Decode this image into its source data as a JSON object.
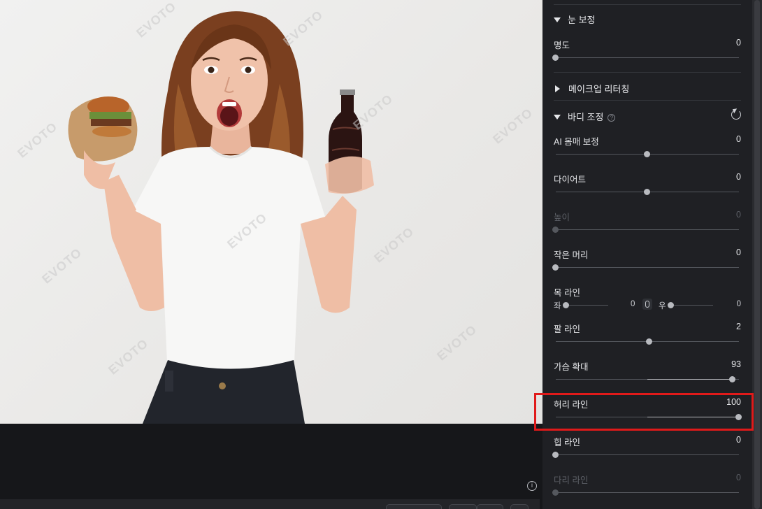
{
  "canvas": {
    "watermark_text": "EVOTO",
    "info_icon": "info-icon"
  },
  "panel": {
    "eye_section": {
      "title": "눈 보정",
      "icon": "triangle-down-icon"
    },
    "brightness": {
      "label": "명도",
      "value": "0",
      "level": 0
    },
    "makeup_section": {
      "title": "메이크업 리터칭",
      "icon": "triangle-right-icon"
    },
    "body_section": {
      "title": "바디 조정",
      "help_icon": "question-icon",
      "reset_icon": "reset-icon"
    },
    "sliders": [
      {
        "label": "AI 몸매 보정",
        "value": "0",
        "level": 0.5,
        "disabled": false
      },
      {
        "label": "다이어트",
        "value": "0",
        "level": 0.5,
        "disabled": false
      },
      {
        "label": "높이",
        "value": "0",
        "level": 0,
        "disabled": true
      },
      {
        "label": "작은 머리",
        "value": "0",
        "level": 0,
        "disabled": false
      }
    ],
    "neck": {
      "label": "목 라인",
      "left_label": "좌",
      "left_value": "0",
      "right_label": "우",
      "right_value": "0",
      "link_icon": "link-icon"
    },
    "sliders2": [
      {
        "label": "팔 라인",
        "value": "2",
        "level": 0.51,
        "disabled": false
      },
      {
        "label": "가슴 확대",
        "value": "93",
        "level": 0.965,
        "disabled": false
      },
      {
        "label": "허리 라인",
        "value": "100",
        "level": 1.0,
        "disabled": false
      },
      {
        "label": "힙 라인",
        "value": "0",
        "level": 0,
        "disabled": false
      },
      {
        "label": "다리 라인",
        "value": "0",
        "level": 0,
        "disabled": true
      }
    ],
    "highlight_color": "#e01a1a"
  }
}
